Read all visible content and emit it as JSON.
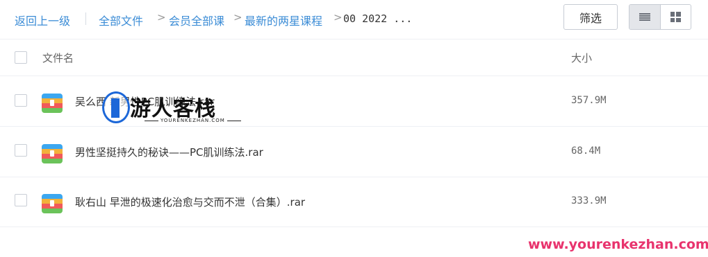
{
  "breadcrumb": {
    "back": "返回上一级",
    "items": [
      "全部文件",
      "会员全部课",
      "最新的两星课程",
      "00 2022 ..."
    ],
    "separator": ">"
  },
  "toolbar": {
    "filter_label": "筛选",
    "view_list_icon": "list-view-icon",
    "view_grid_icon": "grid-view-icon",
    "active_view": "list"
  },
  "table": {
    "columns": [
      "文件名",
      "大小"
    ],
    "rows": [
      {
        "name": "吴么西 新男性PC肌训练法.rar",
        "size": "357.9M",
        "icon": "archive-file-icon"
      },
      {
        "name": "男性坚挺持久的秘诀——PC肌训练法.rar",
        "size": "68.4M",
        "icon": "archive-file-icon"
      },
      {
        "name": "耿右山 早泄的极速化治愈与交而不泄（合集）.rar",
        "size": "333.9M",
        "icon": "archive-file-icon"
      }
    ]
  },
  "watermark": {
    "logo_text": "游人客栈",
    "logo_sub": "YOURENKEZHAN.COM",
    "url": "www.yourenkezhan.com"
  },
  "colors": {
    "link": "#3b8cd6",
    "watermark_url": "#e8336d",
    "logo_blue": "#1c67d8"
  }
}
